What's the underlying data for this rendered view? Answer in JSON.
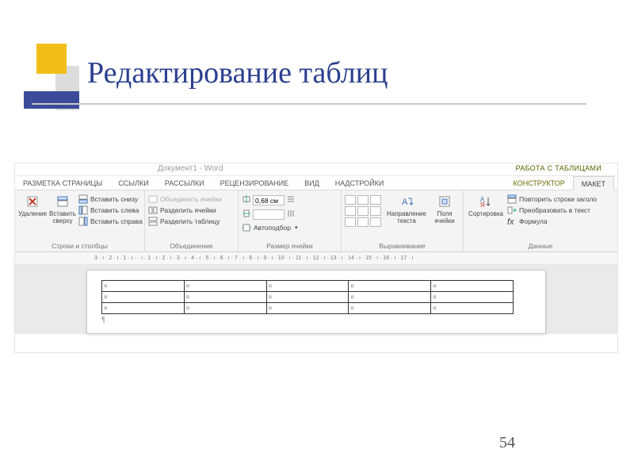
{
  "slide": {
    "title": "Редактирование таблиц",
    "page_number": "54"
  },
  "word": {
    "doc_title": "Документ1 - Word",
    "context_title": "РАБОТА С ТАБЛИЦАМИ",
    "tabs": [
      "РАЗМЕТКА СТРАНИЦЫ",
      "ССЫЛКИ",
      "РАССЫЛКИ",
      "РЕЦЕНЗИРОВАНИЕ",
      "ВИД",
      "НАДСТРОЙКИ"
    ],
    "ctx_tabs": {
      "designer": "КОНСТРУКТОР",
      "layout": "МАКЕТ"
    },
    "groups": {
      "rows_cols": {
        "label": "Строки и столбцы",
        "delete": "Удаление",
        "insert_above": "Вставить сверху",
        "insert_below": "Вставить снизу",
        "insert_left": "Вставить слева",
        "insert_right": "Вставить справа"
      },
      "merge": {
        "label": "Объединение",
        "merge_cells": "Объединить ячейки",
        "split_cells": "Разделить ячейки",
        "split_table": "Разделить таблицу"
      },
      "cell_size": {
        "label": "Размер ячейки",
        "height": "0,68 см",
        "width": "",
        "autofit": "Автоподбор"
      },
      "align": {
        "label": "Выравнивание",
        "text_direction": "Направление текста",
        "cell_margins": "Поля ячейки"
      },
      "data": {
        "label": "Данные",
        "sort": "Сортировка",
        "repeat_header": "Повторить строки заголо",
        "to_text": "Преобразовать в текст",
        "formula": "Формула"
      }
    },
    "ruler": "3 · ı · 2 · ı · 1 · ı ·  · ı · 1 · ı · 2 · ı · 3 · ı · 4 · ı · 5 · ı · 6 · ı · 7 · ı · 8 · ı · 9 · ı · 10 · ı · 11 · ı · 12 · ı · 13 · ı · 14 · ı · 15 · ı · 16 · ı · 17 · ı",
    "pilcrow": "¶",
    "cell_mark": "¤"
  }
}
